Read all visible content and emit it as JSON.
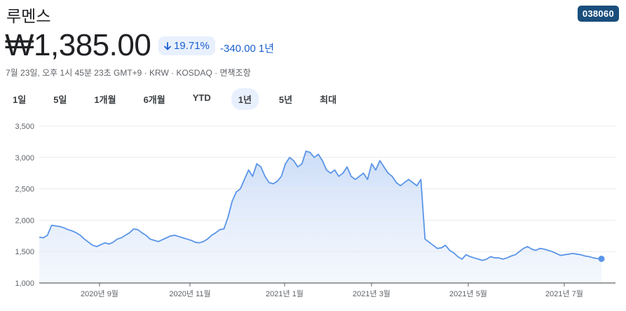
{
  "header": {
    "stock_name": "루멘스",
    "ticker": "038060",
    "price": "₩1,385.00",
    "change_pct": "19.71%",
    "change_abs": "-340.00",
    "change_period": "1년",
    "meta": "7월 23일, 오후 1시 45분 23초 GMT+9 · KRW · KOSDAQ · 면책조항"
  },
  "ranges": [
    "1일",
    "5일",
    "1개월",
    "6개월",
    "YTD",
    "1년",
    "5년",
    "최대"
  ],
  "active_range": "1년",
  "colors": {
    "line": "#5a95e8",
    "accent": "#1a5fd0",
    "badge": "#1a4e7c"
  },
  "icons": {
    "change_direction": "arrow-down-icon"
  },
  "chart_data": {
    "type": "area",
    "title": "",
    "xlabel": "",
    "ylabel": "",
    "ylim": [
      1000,
      3500
    ],
    "yticks": [
      "3,500",
      "3,000",
      "2,500",
      "2,000",
      "1,500",
      "1,000"
    ],
    "xticks": [
      "2020년 9월",
      "2020년 11월",
      "2021년 1월",
      "2021년 3월",
      "2021년 5월",
      "2021년 7월"
    ],
    "grid": true,
    "series": [
      {
        "values": [
          1730,
          1720,
          1760,
          1920,
          1910,
          1900,
          1880,
          1850,
          1830,
          1800,
          1760,
          1700,
          1650,
          1600,
          1580,
          1610,
          1640,
          1620,
          1650,
          1700,
          1720,
          1760,
          1800,
          1860,
          1850,
          1800,
          1760,
          1700,
          1680,
          1660,
          1690,
          1720,
          1750,
          1760,
          1740,
          1720,
          1700,
          1680,
          1650,
          1640,
          1660,
          1700,
          1760,
          1800,
          1850,
          1860,
          2050,
          2300,
          2450,
          2500,
          2650,
          2800,
          2700,
          2900,
          2850,
          2700,
          2600,
          2580,
          2620,
          2700,
          2900,
          3000,
          2950,
          2850,
          2900,
          3100,
          3080,
          3000,
          3050,
          2950,
          2800,
          2750,
          2800,
          2700,
          2750,
          2850,
          2700,
          2650,
          2700,
          2750,
          2650,
          2900,
          2800,
          2950,
          2850,
          2750,
          2700,
          2600,
          2550,
          2600,
          2650,
          2600,
          2550,
          2650,
          1700,
          1650,
          1600,
          1550,
          1560,
          1600,
          1520,
          1480,
          1420,
          1380,
          1450,
          1420,
          1400,
          1380,
          1360,
          1380,
          1420,
          1400,
          1400,
          1380,
          1400,
          1430,
          1450,
          1500,
          1550,
          1580,
          1540,
          1520,
          1550,
          1540,
          1520,
          1500,
          1470,
          1440,
          1450,
          1460,
          1470,
          1460,
          1450,
          1430,
          1420,
          1400,
          1390,
          1385
        ]
      }
    ]
  }
}
